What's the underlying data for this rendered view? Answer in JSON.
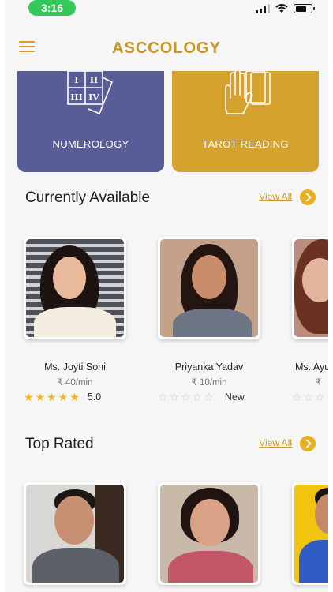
{
  "status_bar": {
    "time": "3:16",
    "icons": [
      "signal-icon",
      "wifi-icon",
      "battery-icon"
    ]
  },
  "header": {
    "menu_icon": "hamburger-menu-icon",
    "brand": "ASCCOLOGY"
  },
  "services": [
    {
      "label": "NUMEROLOGY",
      "icon": "numerology-grid-icon",
      "color": "#585d98",
      "glyphs": [
        "I",
        "II",
        "III",
        "IV"
      ]
    },
    {
      "label": "TAROT READING",
      "icon": "tarot-hand-icon",
      "color": "#d6a22e"
    }
  ],
  "sections": {
    "available": {
      "title": "Currently Available",
      "view_all": "View All",
      "astrologers": [
        {
          "name": "Ms. Joyti Soni",
          "price": "₹ 40/min",
          "rating": 5,
          "score": "5.0"
        },
        {
          "name": "Priyanka Yadav",
          "price": "₹ 10/min",
          "rating": 0,
          "score": "New"
        },
        {
          "name": "Ms. Ayu",
          "price": "₹",
          "rating": 0,
          "score": ""
        }
      ]
    },
    "top_rated": {
      "title": "Top Rated",
      "view_all": "View All"
    }
  },
  "colors": {
    "accent": "#d6a22e",
    "brand_text": "#c9941f",
    "numerology_tile": "#585d98",
    "status_pill": "#34c759",
    "star_on": "#f2b824",
    "star_off": "#c9c9c9"
  }
}
